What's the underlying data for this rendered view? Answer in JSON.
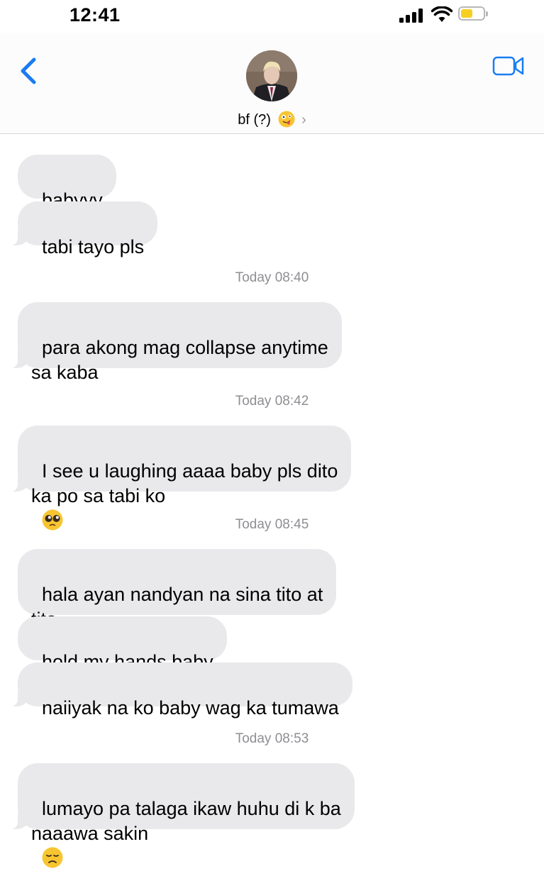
{
  "status_bar": {
    "time": "12:41",
    "battery_color": "#f7cf21"
  },
  "header": {
    "contact_name": "bf (?)",
    "contact_emoji": "zany-face-emoji",
    "back_icon": "chevron-left-icon",
    "video_icon": "video-camera-icon",
    "accent_color": "#1a7cf2"
  },
  "messages": [
    {
      "type": "bubble",
      "text": "babyyy"
    },
    {
      "type": "bubble",
      "text": "tabi tayo pls"
    },
    {
      "type": "timestamp",
      "day": "Today",
      "time": "08:40"
    },
    {
      "type": "bubble",
      "text": "para akong mag collapse anytime\nsa kaba"
    },
    {
      "type": "timestamp",
      "day": "Today",
      "time": "08:42"
    },
    {
      "type": "bubble",
      "text": "I see u laughing aaaa baby pls dito\nka po sa tabi ko",
      "emoji": "pleading-face-emoji"
    },
    {
      "type": "timestamp",
      "day": "Today",
      "time": "08:45"
    },
    {
      "type": "bubble",
      "text": "hala ayan nandyan na sina tito at\ntita"
    },
    {
      "type": "bubble",
      "text": "hold my hands baby"
    },
    {
      "type": "bubble",
      "text": "naiiyak na ko baby wag ka tumawa"
    },
    {
      "type": "timestamp",
      "day": "Today",
      "time": "08:53"
    },
    {
      "type": "bubble",
      "text": "lumayo pa talaga ikaw huhu di k ba\nnaaawa sakin",
      "emoji": "disappointed-face-emoji"
    }
  ]
}
